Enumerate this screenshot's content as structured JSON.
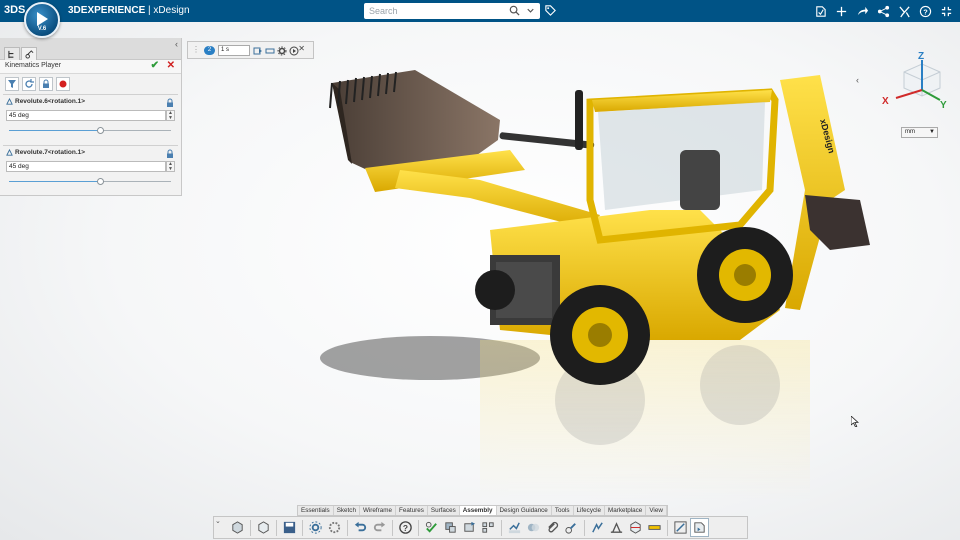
{
  "topbar": {
    "brand_mark": "3DS",
    "compass_version": "V.6",
    "app_name": "3DEXPERIENCE",
    "app_separator": " | ",
    "app_module": "xDesign",
    "search_placeholder": "Search",
    "right_icons": [
      "feedback-icon",
      "add-icon",
      "share-arrow-icon",
      "network-share-icon",
      "tools-icon",
      "help-icon",
      "fullscreen-exit-icon"
    ]
  },
  "panel": {
    "title": "Kinematics Player",
    "tools": [
      "filter-icon",
      "refresh-icon",
      "lock-icon",
      "record-icon"
    ],
    "joints": [
      {
        "label": "Revolute.6<rotation.1>",
        "value": "45 deg",
        "slider": 0.56
      },
      {
        "label": "Revolute.7<rotation.1>",
        "value": "45 deg",
        "slider": 0.56
      }
    ]
  },
  "player": {
    "count": "2",
    "step": "1 s"
  },
  "viewport": {
    "units": "mm",
    "triad": {
      "x": "X",
      "y": "Y",
      "z": "Z"
    },
    "model_decal": "xDesign"
  },
  "action_bar": {
    "tabs": [
      "Essentials",
      "Sketch",
      "Wireframe",
      "Features",
      "Surfaces",
      "Assembly",
      "Design Guidance",
      "Tools",
      "Lifecycle",
      "Marketplace",
      "View"
    ],
    "active_tab": "Assembly"
  },
  "colors": {
    "topbar": "#005386",
    "accent": "#2a7fc4",
    "machine_yellow": "#f2c200",
    "ok": "#2e9b3a",
    "cancel": "#d02020"
  }
}
